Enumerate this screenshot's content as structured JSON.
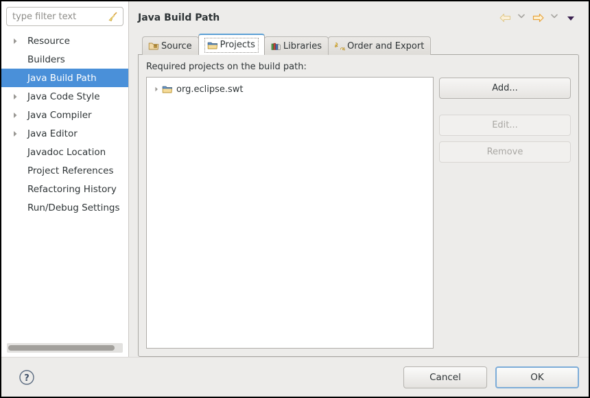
{
  "window": {
    "title": "Java Build Path"
  },
  "sidebar": {
    "filter": {
      "placeholder": "type filter text",
      "value": "",
      "clear_icon": "broom-icon"
    },
    "items": [
      {
        "label": "Resource",
        "expandable": true,
        "selected": false
      },
      {
        "label": "Builders",
        "expandable": false,
        "selected": false
      },
      {
        "label": "Java Build Path",
        "expandable": false,
        "selected": true
      },
      {
        "label": "Java Code Style",
        "expandable": true,
        "selected": false
      },
      {
        "label": "Java Compiler",
        "expandable": true,
        "selected": false
      },
      {
        "label": "Java Editor",
        "expandable": true,
        "selected": false
      },
      {
        "label": "Javadoc Location",
        "expandable": false,
        "selected": false
      },
      {
        "label": "Project References",
        "expandable": false,
        "selected": false
      },
      {
        "label": "Refactoring History",
        "expandable": false,
        "selected": false
      },
      {
        "label": "Run/Debug Settings",
        "expandable": false,
        "selected": false
      }
    ],
    "scrollbar": {
      "orientation": "horizontal"
    }
  },
  "header": {
    "title": "Java Build Path",
    "nav": [
      {
        "name": "back-arrow-icon",
        "state": "disabled"
      },
      {
        "name": "back-dropdown-icon",
        "state": "enabled"
      },
      {
        "name": "forward-arrow-icon",
        "state": "enabled"
      },
      {
        "name": "forward-dropdown-icon",
        "state": "enabled"
      },
      {
        "name": "view-menu-icon",
        "state": "enabled"
      }
    ]
  },
  "tabs": [
    {
      "label": "Source",
      "icon": "source-folder-icon",
      "active": false
    },
    {
      "label": "Projects",
      "icon": "projects-folder-icon",
      "active": true
    },
    {
      "label": "Libraries",
      "icon": "libraries-books-icon",
      "active": false
    },
    {
      "label": "Order and Export",
      "icon": "order-export-icon",
      "active": false
    }
  ],
  "main": {
    "list_label": "Required projects on the build path:",
    "projects": [
      {
        "label": "org.eclipse.swt",
        "icon": "project-folder-icon",
        "expandable": true
      }
    ],
    "buttons": [
      {
        "label": "Add...",
        "enabled": true
      },
      {
        "label": "Edit...",
        "enabled": false
      },
      {
        "label": "Remove",
        "enabled": false
      }
    ]
  },
  "footer": {
    "help_icon": "help-question-icon",
    "cancel_label": "Cancel",
    "ok_label": "OK"
  },
  "colors": {
    "selection_blue": "#4a90d9",
    "active_tab_top": "#5a9fd4",
    "default_button_border": "#7cacd8",
    "window_bg": "#edecea",
    "forward_arrow": "#e8a33d",
    "back_arrow_disabled": "#e6d5ac"
  }
}
